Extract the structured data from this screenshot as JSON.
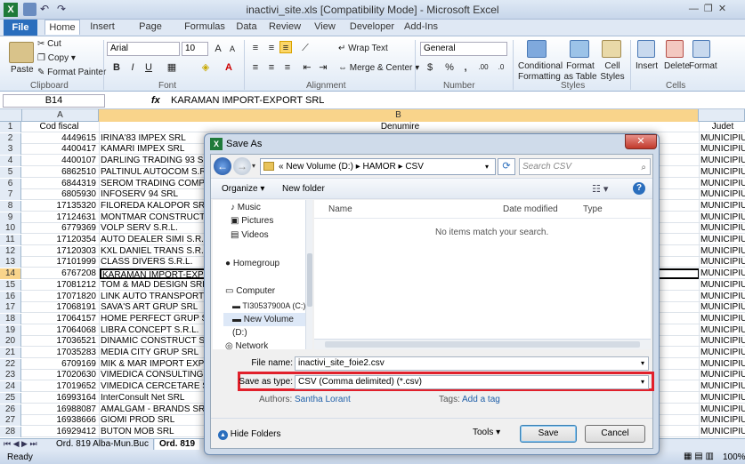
{
  "window": {
    "title": "inactivi_site.xls [Compatibility Mode] - Microsoft Excel"
  },
  "tabs": [
    "File",
    "Home",
    "Insert",
    "Page Layout",
    "Formulas",
    "Data",
    "Review",
    "View",
    "Developer",
    "Add-Ins"
  ],
  "ribbon": {
    "clipboard": {
      "paste": "Paste",
      "cut": "Cut",
      "copy": "Copy",
      "format_painter": "Format Painter",
      "label": "Clipboard"
    },
    "font": {
      "name": "Arial",
      "size": "10",
      "label": "Font"
    },
    "alignment": {
      "wrap": "Wrap Text",
      "merge": "Merge & Center",
      "label": "Alignment"
    },
    "number": {
      "format": "General",
      "label": "Number"
    },
    "styles": {
      "cond": "Conditional",
      "cond2": "Formatting",
      "table": "Format",
      "table2": "as Table",
      "cell": "Cell",
      "cell2": "Styles",
      "label": "Styles"
    },
    "cells": {
      "insert": "Insert",
      "delete": "Delete",
      "format": "Format",
      "label": "Cells"
    }
  },
  "formula_bar": {
    "name_box": "B14",
    "fx": "fx",
    "value": "KARAMAN IMPORT-EXPORT SRL"
  },
  "columns": {
    "A": "A",
    "B": "B",
    "C": ""
  },
  "rows": [
    {
      "n": "1",
      "a": "Cod fiscal",
      "b": "Denumire",
      "c": "Judet"
    },
    {
      "n": "2",
      "a": "4449615",
      "b": "IRINA'83 IMPEX SRL",
      "c": "MUNICIPIUL"
    },
    {
      "n": "3",
      "a": "4400417",
      "b": "KAMARI IMPEX SRL",
      "c": "MUNICIPIUL"
    },
    {
      "n": "4",
      "a": "4400107",
      "b": "DARLING TRADING 93 SR",
      "c": "MUNICIPIUL"
    },
    {
      "n": "5",
      "a": "6862510",
      "b": "PALTINUL AUTOCOM S.R",
      "c": "MUNICIPIUL"
    },
    {
      "n": "6",
      "a": "6844319",
      "b": "SEROM TRADING COMPA",
      "c": "MUNICIPIUL"
    },
    {
      "n": "7",
      "a": "6805930",
      "b": "INFOSERV 94 SRL",
      "c": "MUNICIPIUL"
    },
    {
      "n": "8",
      "a": "17135320",
      "b": "FILOREDA KALOPOR SRL",
      "c": "MUNICIPIUL"
    },
    {
      "n": "9",
      "a": "17124631",
      "b": "MONTMAR CONSTRUCT S",
      "c": "MUNICIPIUL"
    },
    {
      "n": "10",
      "a": "6779369",
      "b": "VOLP SERV S.R.L.",
      "c": "MUNICIPIUL"
    },
    {
      "n": "11",
      "a": "17120354",
      "b": "AUTO DEALER SIMI S.R.L",
      "c": "MUNICIPIUL"
    },
    {
      "n": "12",
      "a": "17120303",
      "b": "KXL DANIEL TRANS S.R.L",
      "c": "MUNICIPIUL"
    },
    {
      "n": "13",
      "a": "17101999",
      "b": "CLASS DIVERS S.R.L.",
      "c": "MUNICIPIUL"
    },
    {
      "n": "14",
      "a": "6767208",
      "b": "KARAMAN IMPORT-EXPO",
      "c": "MUNICIPIUL"
    },
    {
      "n": "15",
      "a": "17081212",
      "b": "TOM & MAD DESIGN SRL",
      "c": "MUNICIPIUL"
    },
    {
      "n": "16",
      "a": "17071820",
      "b": "LINK AUTO TRANSPORT S",
      "c": "MUNICIPIUL"
    },
    {
      "n": "17",
      "a": "17068191",
      "b": "SAVA'S ART GRUP SRL",
      "c": "MUNICIPIUL"
    },
    {
      "n": "18",
      "a": "17064157",
      "b": "HOME PERFECT GRUP S",
      "c": "MUNICIPIUL"
    },
    {
      "n": "19",
      "a": "17064068",
      "b": "LIBRA CONCEPT S.R.L.",
      "c": "MUNICIPIUL"
    },
    {
      "n": "20",
      "a": "17036521",
      "b": "DINAMIC CONSTRUCT SY",
      "c": "MUNICIPIUL"
    },
    {
      "n": "21",
      "a": "17035283",
      "b": "MEDIA CITY GRUP SRL",
      "c": "MUNICIPIUL"
    },
    {
      "n": "22",
      "a": "6709169",
      "b": "MIK & MAR IMPORT EXPO",
      "c": "MUNICIPIUL"
    },
    {
      "n": "23",
      "a": "17020630",
      "b": "VIMEDICA CONSULTING S",
      "c": "MUNICIPIUL"
    },
    {
      "n": "24",
      "a": "17019652",
      "b": "VIMEDICA CERCETARE S",
      "c": "MUNICIPIUL"
    },
    {
      "n": "25",
      "a": "16993164",
      "b": "InterConsult Net SRL",
      "c": "MUNICIPIUL"
    },
    {
      "n": "26",
      "a": "16988087",
      "b": "AMALGAM - BRANDS SR",
      "c": "MUNICIPIUL"
    },
    {
      "n": "27",
      "a": "16938666",
      "b": "GIOMI PROD SRL",
      "c": "MUNICIPIUL"
    },
    {
      "n": "28",
      "a": "16929412",
      "b": "BUTON MOB SRL",
      "c": "MUNICIPIUL"
    }
  ],
  "sheet_tabs": [
    "Ord. 819  Alba-Mun.Buc",
    "Ord. 819"
  ],
  "status": {
    "ready": "Ready",
    "zoom": "100%"
  },
  "dialog": {
    "title": "Save As",
    "path": [
      "New Volume (D:)",
      "HAMOR",
      "CSV"
    ],
    "search_placeholder": "Search CSV",
    "organize": "Organize",
    "new_folder": "New folder",
    "nav": [
      "Music",
      "Pictures",
      "Videos",
      "Homegroup",
      "Computer",
      "TI30537900A (C:)",
      "New Volume (D:)",
      "Network"
    ],
    "col_name": "Name",
    "col_date": "Date modified",
    "col_type": "Type",
    "empty": "No items match your search.",
    "file_name_label": "File name:",
    "file_name": "inactivi_site_foie2.csv",
    "save_type_label": "Save as type:",
    "save_type": "CSV (Comma delimited) (*.csv)",
    "authors_label": "Authors:",
    "authors": "Santha Lorant",
    "tags_label": "Tags:",
    "tags": "Add a tag",
    "hide_folders": "Hide Folders",
    "tools": "Tools",
    "save": "Save",
    "cancel": "Cancel"
  }
}
